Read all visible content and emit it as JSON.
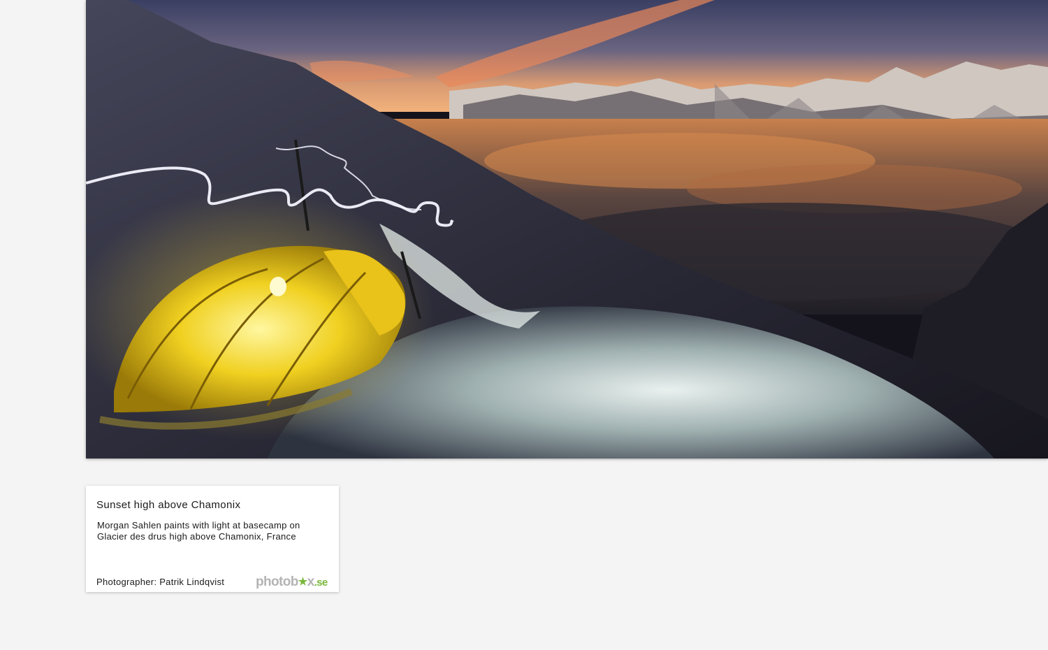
{
  "photo": {
    "subject": "Sunset high above Chamonix"
  },
  "caption": {
    "title": "Sunset high above Chamonix",
    "description": "Morgan Sahlen paints with light at basecamp on Glacier des drus high above Chamonix, France",
    "credit": "Photographer: Patrik Lindqvist"
  },
  "logo": {
    "part1": "photob",
    "star": "★",
    "part2": "x",
    "suffix": ".se"
  },
  "colors": {
    "background": "#f4f4f4",
    "logo_gray": "#b4b4b4",
    "logo_green": "#7ab83a",
    "tent_yellow": "#f0d020"
  }
}
